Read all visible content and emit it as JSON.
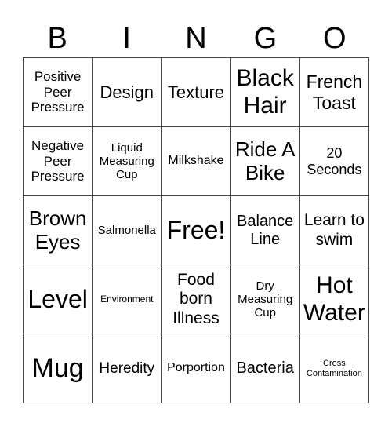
{
  "header": [
    "B",
    "I",
    "N",
    "G",
    "O"
  ],
  "rows": [
    [
      "Positive Peer Pressure",
      "Design",
      "Texture",
      "Black Hair",
      "French Toast"
    ],
    [
      "Negative Peer Pressure",
      "Liquid Measuring Cup",
      "Milkshake",
      "Ride A Bike",
      "20 Seconds"
    ],
    [
      "Brown Eyes",
      "Salmonella",
      "Free!",
      "Balance Line",
      "Learn to swim"
    ],
    [
      "Level",
      "Environment",
      "Food born Illness",
      "Dry Measuring Cup",
      "Hot Water"
    ],
    [
      "Mug",
      "Heredity",
      "Porportion",
      "Bacteria",
      "Cross Contamination"
    ]
  ]
}
